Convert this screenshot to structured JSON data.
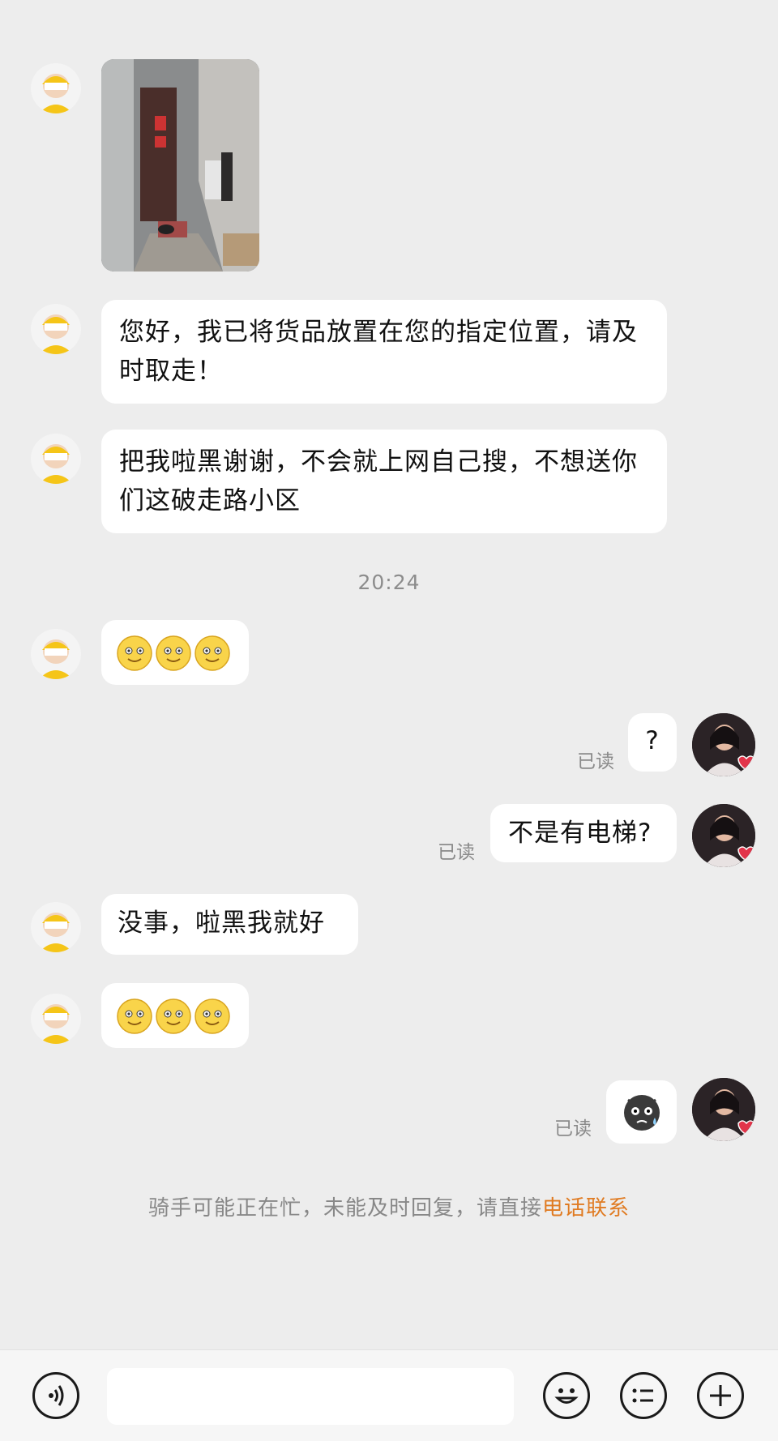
{
  "messages": {
    "m1_text": "您好，我已将货品放置在您的指定位置，请及时取走！",
    "m2_text": "把我啦黑谢谢，不会就上网自己搜，不想送你们这破走路小区",
    "timestamp": "20:24",
    "m4_text": "?",
    "m5_text": "不是有电梯?",
    "m6_text": "没事，啦黑我就好",
    "read_label": "已读"
  },
  "notice": {
    "text": "骑手可能正在忙，未能及时回复，请直接",
    "link": "电话联系"
  },
  "colors": {
    "background": "#ededed",
    "bubble": "#ffffff",
    "link": "#e07b22",
    "courier_helmet": "#f5c518"
  },
  "icons": {
    "voice": "voice-icon",
    "emoji": "emoji-icon",
    "quick_reply": "quick-reply-icon",
    "more": "plus-icon"
  }
}
